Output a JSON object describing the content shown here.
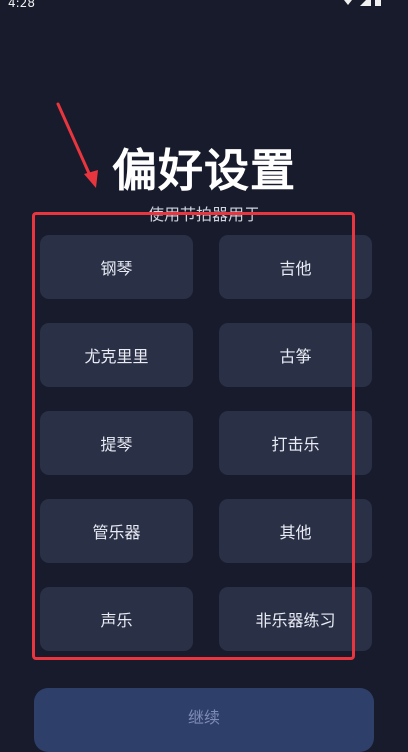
{
  "status_bar": {
    "time": "4:28"
  },
  "header": {
    "title": "偏好设置",
    "subtitle": "使用节拍器用于"
  },
  "options": [
    {
      "label": "钢琴"
    },
    {
      "label": "吉他"
    },
    {
      "label": "尤克里里"
    },
    {
      "label": "古筝"
    },
    {
      "label": "提琴"
    },
    {
      "label": "打击乐"
    },
    {
      "label": "管乐器"
    },
    {
      "label": "其他"
    },
    {
      "label": "声乐"
    },
    {
      "label": "非乐器练习"
    }
  ],
  "footer": {
    "continue_label": "继续"
  },
  "colors": {
    "background": "#171b2c",
    "card": "#2a3045",
    "annotation": "#e8353e",
    "button": "#2e3f6a"
  }
}
